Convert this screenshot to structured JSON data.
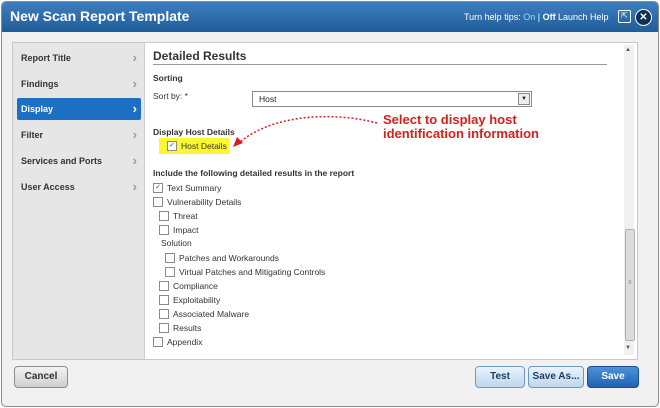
{
  "window": {
    "title": "New Scan Report Template",
    "help_tips_label": "Turn help tips:",
    "help_tips_on": "On",
    "help_tips_sep": "|",
    "help_tips_off": "Off",
    "launch_help": "Launch Help",
    "popout_icon": "popout-icon",
    "close_icon": "close-icon"
  },
  "sidebar": {
    "items": [
      {
        "label": "Report Title",
        "active": false
      },
      {
        "label": "Findings",
        "active": false
      },
      {
        "label": "Display",
        "active": true
      },
      {
        "label": "Filter",
        "active": false
      },
      {
        "label": "Services and Ports",
        "active": false
      },
      {
        "label": "User Access",
        "active": false
      }
    ]
  },
  "main": {
    "heading": "Detailed Results",
    "sorting": {
      "heading": "Sorting",
      "sort_by_label": "Sort by: *",
      "sort_by_value": "Host"
    },
    "host_details": {
      "heading": "Display Host Details",
      "checkbox_label": "Host Details",
      "checked": true
    },
    "callout": {
      "line1": "Select to display host",
      "line2": "identification information",
      "color": "#d42020"
    },
    "include": {
      "heading": "Include the following detailed results in the report",
      "text_summary": {
        "label": "Text Summary",
        "checked": true
      },
      "vulnerability_details": {
        "label": "Vulnerability Details",
        "checked": false
      },
      "threat": {
        "label": "Threat",
        "checked": false
      },
      "impact": {
        "label": "Impact",
        "checked": false
      },
      "solution_label": "Solution",
      "patches_and_workarounds": {
        "label": "Patches and Workarounds",
        "checked": false
      },
      "virtual_patches": {
        "label": "Virtual Patches and Mitigating Controls",
        "checked": false
      },
      "compliance": {
        "label": "Compliance",
        "checked": false
      },
      "exploitability": {
        "label": "Exploitability",
        "checked": false
      },
      "associated_malware": {
        "label": "Associated Malware",
        "checked": false
      },
      "results": {
        "label": "Results",
        "checked": false
      },
      "appendix": {
        "label": "Appendix",
        "checked": false
      }
    }
  },
  "footer": {
    "cancel": "Cancel",
    "test": "Test",
    "save_as": "Save As...",
    "save": "Save"
  },
  "colors": {
    "title_bar": "#1f5c99",
    "active_nav": "#1d6fc4",
    "highlight": "#fbf733",
    "primary_button": "#1e63b3"
  }
}
